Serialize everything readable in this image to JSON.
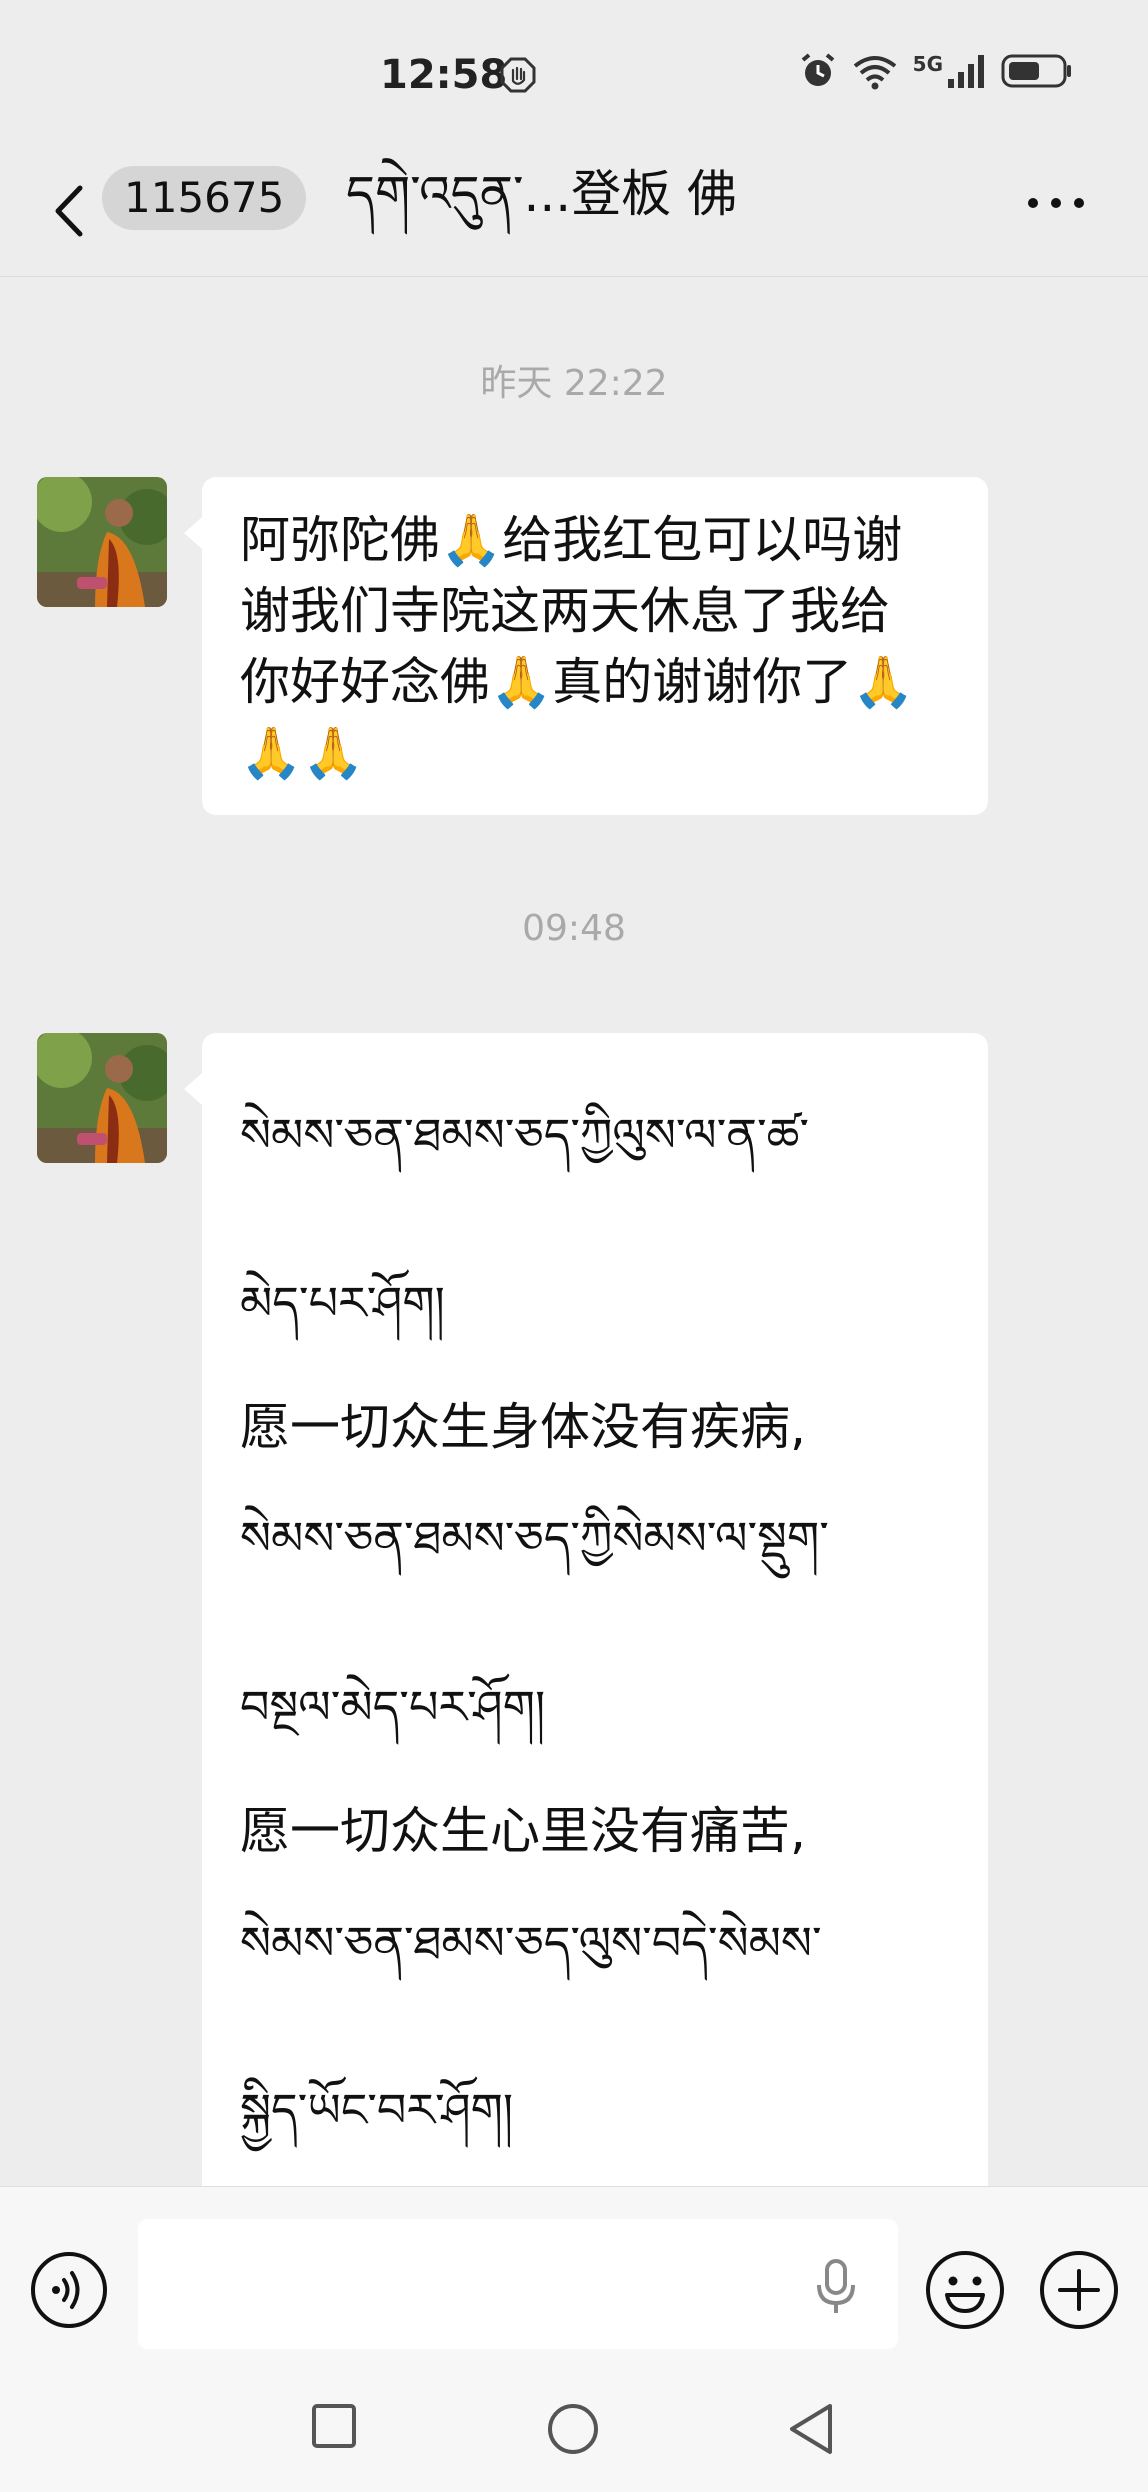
{
  "status_bar": {
    "time": "12:58",
    "network": "5G",
    "icons": [
      "hand-stop-icon",
      "alarm-icon",
      "wifi-icon",
      "signal-icon",
      "battery-icon"
    ]
  },
  "nav": {
    "unread_count": "115675",
    "title": "དགེ་འདུན་...登板  佛",
    "icons": [
      "back-arrow-icon",
      "more-icon"
    ]
  },
  "messages": [
    {
      "timestamp": "昨天 22:22",
      "lines": [
        "阿弥陀佛🙏给我红包可以吗谢",
        "谢我们寺院这两天休息了我给",
        "你好好念佛🙏真的谢谢你了🙏",
        "🙏🙏"
      ]
    },
    {
      "timestamp": "09:48",
      "lines": [
        "སེམས་ཅན་ཐམས་ཅད་ཀྱིལུས་ལ་ན་ཚ་",
        "མེད་པར་ཤོག།",
        "愿一切众生身体没有疾病,",
        "སེམས་ཅན་ཐམས་ཅད་ཀྱིསེམས་ལ་སྡུག་",
        "བསྔལ་མེད་པར་ཤོག།",
        "愿一切众生心里没有痛苦,",
        "སེམས་ཅན་ཐམས་ཅད་ལུས་བདེ་སེམས་",
        "སྐྱིད་ཡོང་བར་ཤོག།"
      ]
    }
  ],
  "input_bar": {
    "placeholder": "",
    "icons": [
      "voice-icon",
      "microphone-icon",
      "emoji-icon",
      "plus-icon"
    ]
  },
  "system_nav": {
    "icons": [
      "recents-square-icon",
      "home-circle-icon",
      "back-triangle-icon"
    ]
  },
  "colors": {
    "background": "#ededed",
    "bubble": "#ffffff",
    "timestamp": "#a9a9a9"
  }
}
